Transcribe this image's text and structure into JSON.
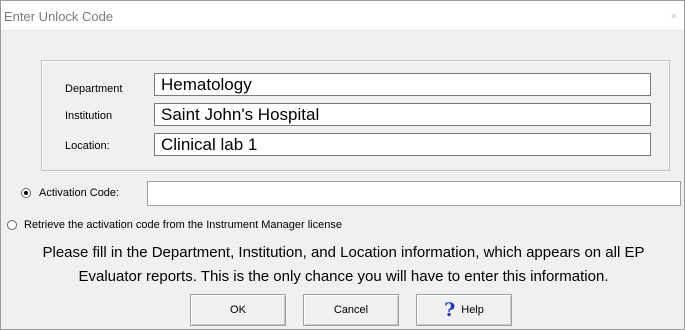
{
  "window": {
    "title": "Enter Unlock Code",
    "close_glyph": "×"
  },
  "fields": [
    {
      "label": "Department",
      "value": "Hematology"
    },
    {
      "label": "Institution",
      "value": "Saint John's Hospital"
    },
    {
      "label": "Location:",
      "value": "Clinical lab 1"
    }
  ],
  "activation": {
    "selected_option": "activation-code",
    "code_label": "Activation Code:",
    "code_value": "",
    "retrieve_label": "Retrieve the activation code from the Instrument Manager license"
  },
  "info": {
    "line1": "Please fill in the Department, Institution, and Location information, which appears on all EP",
    "line2": "Evaluator reports. This is the only chance you will have to enter this information."
  },
  "buttons": {
    "ok": "OK",
    "cancel": "Cancel",
    "help": "Help",
    "help_icon": "question-mark-icon"
  },
  "colors": {
    "help_icon": "#1a37c4",
    "dialog_bg": "#f0f0f0"
  }
}
